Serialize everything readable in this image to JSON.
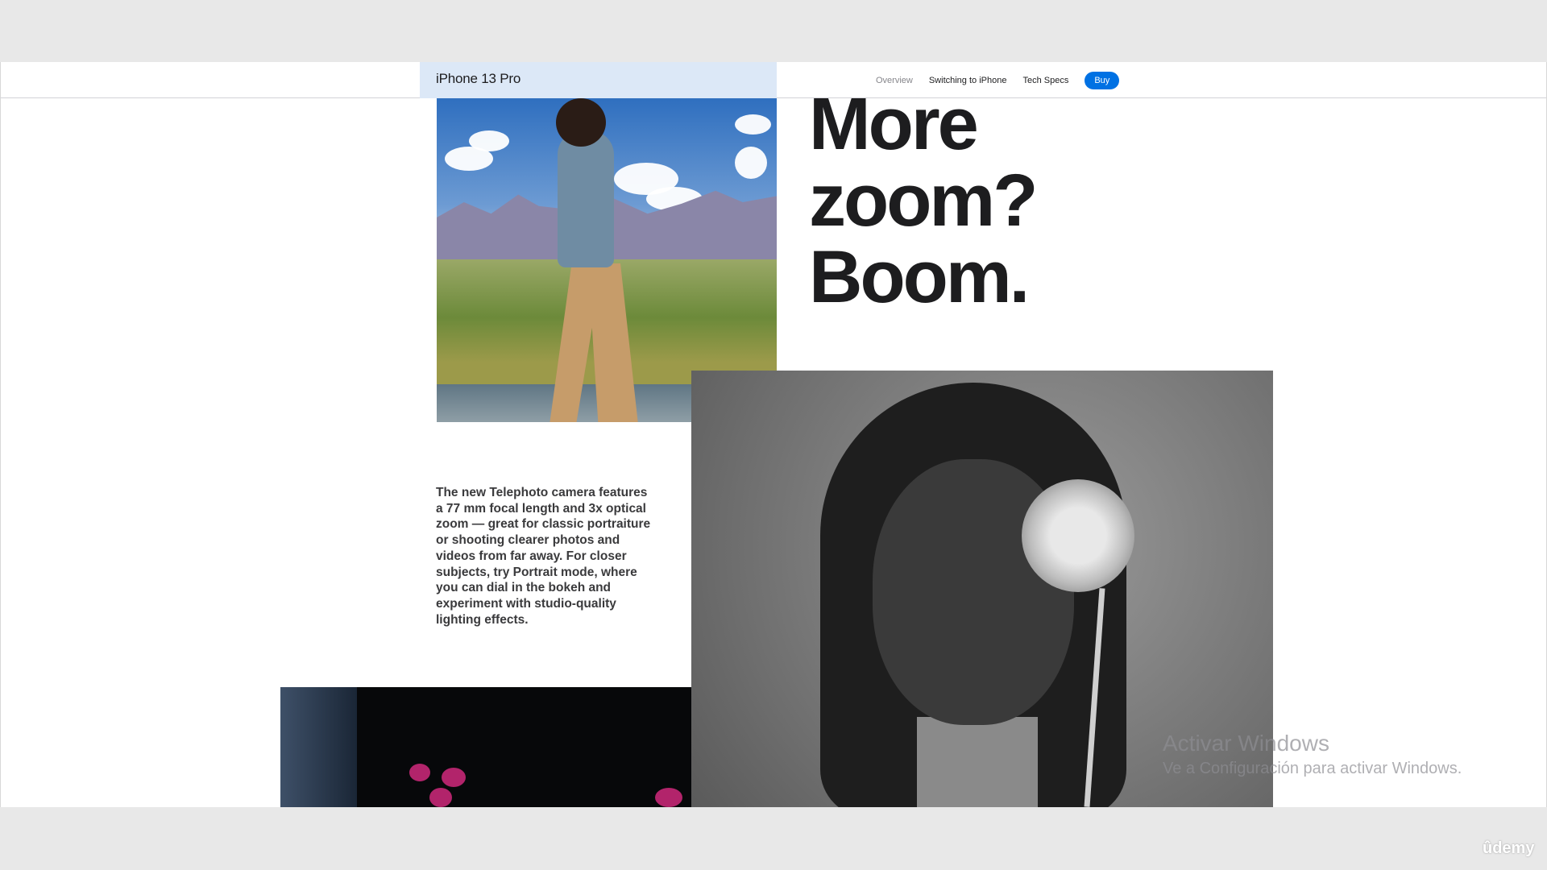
{
  "nav": {
    "title": "iPhone 13 Pro",
    "links": [
      "Overview",
      "Switching to iPhone",
      "Tech Specs"
    ],
    "buy_label": "Buy"
  },
  "headline": {
    "lines": [
      "More",
      "zoom?",
      "Boom."
    ]
  },
  "body_text": "The new Telephoto camera features a 77 mm focal length and 3x optical zoom — great for classic portraiture or shooting clearer photos and videos from far away. For closer subjects, try Portrait mode, where you can dial in the bokeh and experiment with studio-quality lighting effects.",
  "watermark": {
    "title": "Activar Windows",
    "subtitle": "Ve a Configuración para activar Windows."
  },
  "brand_overlay": "ûdemy",
  "colors": {
    "accent": "#0071e3",
    "text": "#1d1d1f",
    "page_bg": "#e8e8e8"
  }
}
